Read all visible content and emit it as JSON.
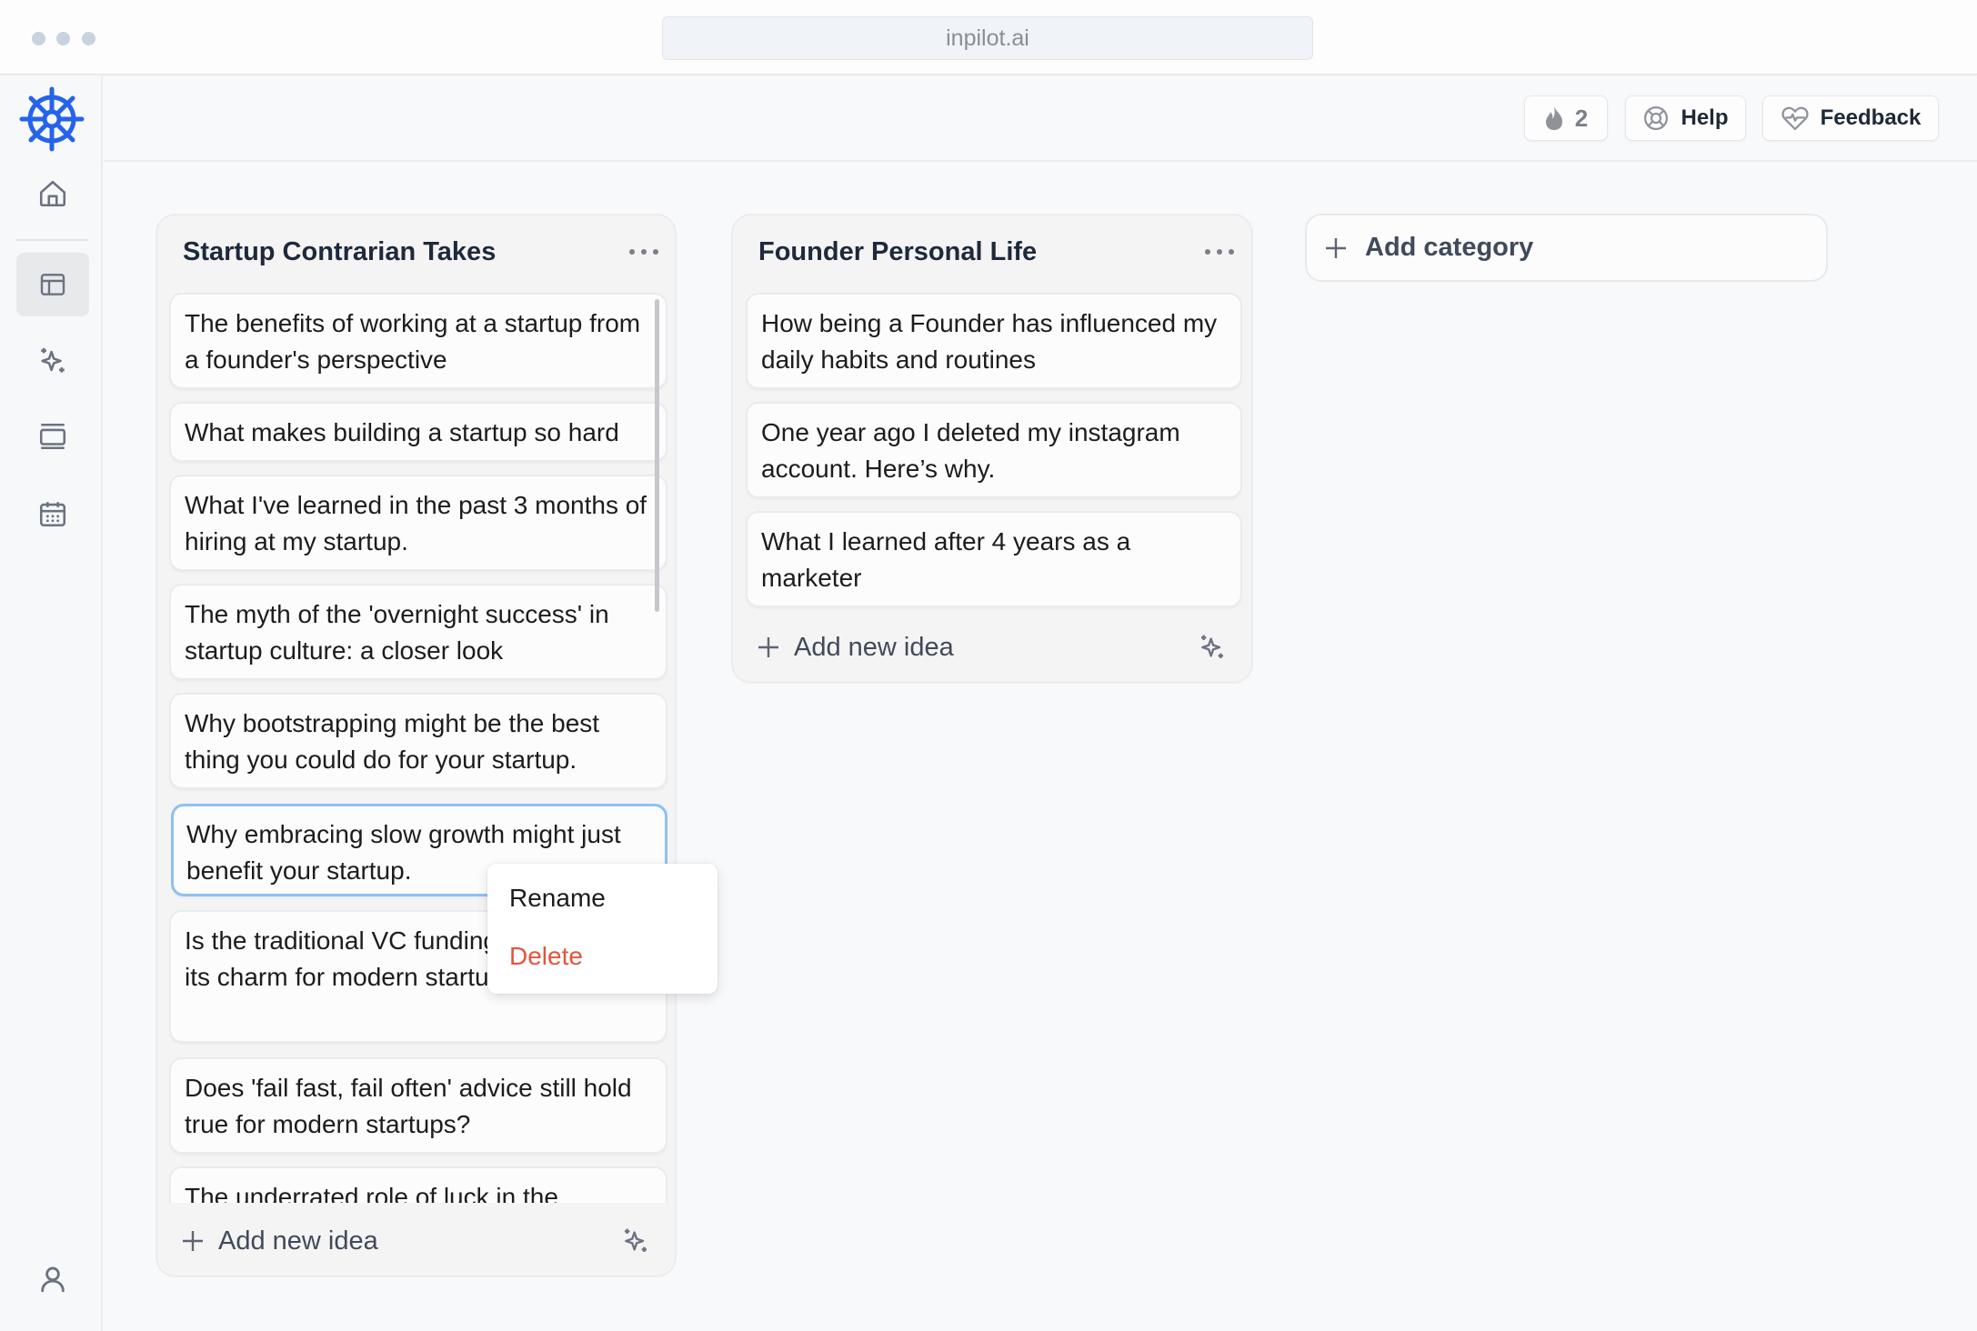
{
  "browser": {
    "url": "inpilot.ai"
  },
  "colors": {
    "brand": "#2563eb",
    "danger": "#e5533d",
    "selected_border": "#8ec0f5"
  },
  "sidebar": {
    "logo_icon": "ship-wheel-icon",
    "items": [
      {
        "name": "home",
        "icon": "home-icon",
        "active": false
      },
      {
        "name": "ideas-board",
        "icon": "table-icon",
        "active": true
      },
      {
        "name": "ai-generate",
        "icon": "sparkles-icon",
        "active": false
      },
      {
        "name": "posts",
        "icon": "slides-icon",
        "active": false
      },
      {
        "name": "calendar",
        "icon": "calendar-icon",
        "active": false
      }
    ],
    "bottom_item": {
      "name": "profile",
      "icon": "user-icon"
    }
  },
  "header": {
    "streak_count": "2",
    "help_label": "Help",
    "feedback_label": "Feedback"
  },
  "board": {
    "columns": [
      {
        "title": "Startup Contrarian Takes",
        "ideas": [
          "The benefits of working at a startup from a founder's perspective",
          "What makes building a startup so hard",
          "What I've learned in the past 3 months of hiring at my startup.",
          "The myth of the 'overnight success' in startup culture: a closer look",
          "Why bootstrapping might be the best thing you could do for your startup.",
          "Why embracing slow growth might just benefit your startup.",
          "Is the traditional VC funding model losing its charm for modern startups?",
          "Does 'fail fast, fail often' advice still hold true for modern startups?",
          "The underrated role of luck in the"
        ],
        "selected_index": 5,
        "add_label": "Add new idea"
      },
      {
        "title": "Founder Personal Life",
        "ideas": [
          "How being a Founder has influenced my daily habits and routines",
          "One year ago I deleted my instagram account. Here’s why.",
          "What I learned after 4 years as a marketer"
        ],
        "add_label": "Add new idea"
      }
    ],
    "add_category_label": "Add category"
  },
  "context_menu": {
    "items": [
      {
        "label": "Rename",
        "danger": false
      },
      {
        "label": "Delete",
        "danger": true
      }
    ]
  }
}
